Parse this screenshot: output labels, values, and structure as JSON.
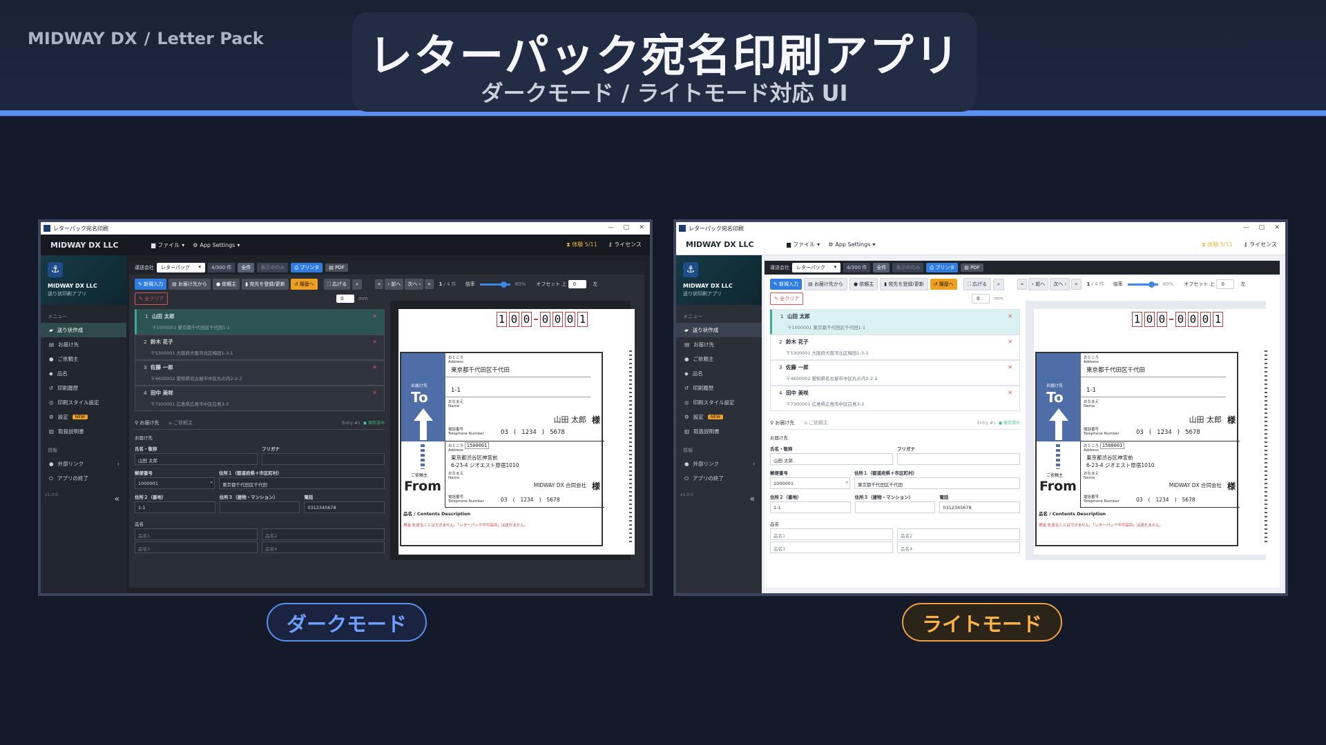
{
  "banner": {
    "brand_left": "MIDWAY DX",
    "brand_sep": "/",
    "brand_right": "Letter Pack",
    "title": "レターパック宛名印刷アプリ",
    "subtitle": "ダークモード / ライトモード対応 UI"
  },
  "colors": {
    "accent_blue": "#5b8ff0",
    "accent_orange": "#f0a040",
    "teal_active": "#3fa7a0",
    "postal_red": "#c53a3a",
    "label_blue": "#4f6ea8"
  },
  "app": {
    "window_title": "レターパック宛名印刷",
    "company": "MIDWAY DX LLC",
    "menu": {
      "file": "ファイル",
      "settings": "App Settings"
    },
    "trial": "体験 5/11",
    "license": "ライセンス",
    "sidebar": {
      "company": "MIDWAY DX LLC",
      "tagline": "送り状印刷アプリ",
      "menu_label": "メニュー",
      "items": [
        {
          "label": "送り状作成",
          "icon": "truck-icon"
        },
        {
          "label": "お届け先",
          "icon": "book-icon"
        },
        {
          "label": "ご依頼主",
          "icon": "person-icon"
        },
        {
          "label": "品名",
          "icon": "tag-icon"
        },
        {
          "label": "印刷履歴",
          "icon": "history-icon"
        },
        {
          "label": "印刷スタイル設定",
          "icon": "style-icon"
        },
        {
          "label": "設定",
          "icon": "gear-icon",
          "badge": "NEW"
        },
        {
          "label": "取扱説明書",
          "icon": "manual-icon"
        }
      ],
      "info_label": "情報",
      "info_items": [
        {
          "label": "外部リンク",
          "icon": "link-icon"
        },
        {
          "label": "アプリの終了",
          "icon": "power-icon"
        }
      ],
      "version": "v1.0.0",
      "collapse": "«"
    },
    "toolbar1": {
      "carrier_label": "運送会社",
      "carrier_value": "レターパック",
      "count": "4/300 件",
      "all": "全件",
      "shown_only": "表示中のみ",
      "printer": "プリンタ",
      "pdf": "PDF"
    },
    "toolbar2": {
      "new": "新規入力",
      "from_dest": "お届け先から",
      "from_sender": "依頼主",
      "register": "宛先を登録/更新",
      "history": "履歴へ",
      "expand": "広げる",
      "search": "⌕",
      "clear": "全クリア",
      "first": "«",
      "prev": "‹ 前へ",
      "next": "次へ ›",
      "last": "»",
      "page": "1",
      "page_total": "/ 4 件",
      "zoom_label": "倍率",
      "zoom_value": "80%",
      "zoom_fraction": 0.8,
      "offset_label": "オフセット 上",
      "offset_top": "0",
      "left_label": "左",
      "offset_left": "0",
      "unit": "mm"
    },
    "entries": [
      {
        "num": "1",
        "name": "山田 太郎",
        "zip": "〒1000001",
        "addr": "東京都千代田区千代田1-1"
      },
      {
        "num": "2",
        "name": "鈴木 花子",
        "zip": "〒5300001",
        "addr": "大阪府大阪市北区梅田1-3-1"
      },
      {
        "num": "3",
        "name": "佐藤 一郎",
        "zip": "〒4600002",
        "addr": "愛知県名古屋市中区丸の内2-2-2"
      },
      {
        "num": "4",
        "name": "田中 美咲",
        "zip": "〒7300001",
        "addr": "広島県広島市中区白島3-3"
      }
    ],
    "form": {
      "tab_dest": "お届け先",
      "tab_sender": "ご依頼主",
      "entry_no": "Entry #1",
      "saved": "● 保存済み",
      "section": "お届け先",
      "name_label": "氏名・敬称",
      "kana_label": "フリガナ",
      "name_value": "山田 太郎",
      "zip_label": "郵便番号",
      "addr1_label": "住所１（都道府県＋市区町村）",
      "zip_value": "1000001",
      "addr1_value": "東京都千代田区千代田",
      "addr2_label": "住所２（番地）",
      "addr3_label": "住所３（建物・マンション）",
      "tel_label": "電話",
      "addr2_value": "1-1",
      "tel_value": "0312345678",
      "items_label": "品名",
      "item1": "品名1",
      "item2": "品名2",
      "item3": "品名3",
      "item4": "品名4"
    },
    "label": {
      "postal_digits": [
        "1",
        "0",
        "0",
        "0",
        "0",
        "0",
        "1"
      ],
      "to_small": "お届け先",
      "to": "To",
      "from_small": "ご依頼主",
      "from": "From",
      "addr_title": "おところ",
      "addr_en": "Address",
      "name_title": "おなまえ",
      "name_en": "Name",
      "tel_title": "電話番号",
      "tel_en": "Telephone Number",
      "to_addr1": "東京都千代田区千代田",
      "to_addr2": "1-1",
      "to_name": "山田 太郎",
      "to_tel_a": "03",
      "to_tel_b": "1234",
      "to_tel_c": "5678",
      "sama": "様",
      "from_zip": "1500001",
      "from_addr1": "東京都渋谷区神宮前",
      "from_addr2": "6-23-4 ジオエスト原宿1010",
      "from_name": "MIDWAY DX 合同会社",
      "from_tel_a": "03",
      "from_tel_b": "1234",
      "from_tel_c": "5678",
      "contents_title": "品名 / Contents Description",
      "warning": "現金 を送ることはできません。「レターパック不可品目」は送れません。"
    }
  },
  "modes": {
    "dark": "ダークモード",
    "light": "ライトモード"
  }
}
